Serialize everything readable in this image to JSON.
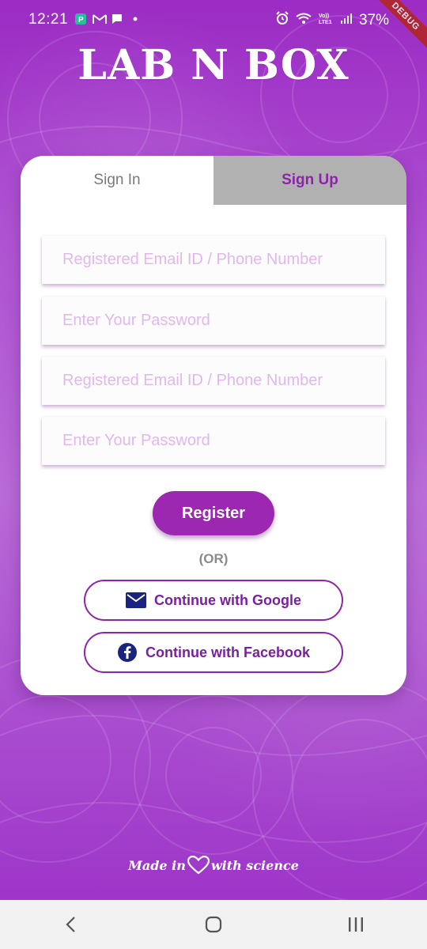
{
  "status_bar": {
    "time": "12:21",
    "battery": "37%",
    "left_icons": [
      "pay-icon",
      "gmail-icon",
      "message-icon",
      "dot-icon"
    ],
    "right_icons": [
      "alarm-icon",
      "wifi-icon",
      "volte-icon",
      "signal-icon"
    ],
    "debug_label": "DEBUG"
  },
  "app": {
    "logo": "LAB N BOX"
  },
  "tabs": {
    "sign_in": "Sign In",
    "sign_up": "Sign Up"
  },
  "form": {
    "field1_placeholder": "Registered Email ID / Phone Number",
    "field2_placeholder": "Enter Your Password",
    "field3_placeholder": "Registered Email ID / Phone Number",
    "field4_placeholder": "Enter Your Password",
    "register_label": "Register",
    "or_label": "(OR)",
    "google_label": "Continue with Google",
    "facebook_label": "Continue with Facebook"
  },
  "footer": {
    "made_in": "Made in",
    "with_science": "with science"
  },
  "colors": {
    "primary": "#9c27b0",
    "tab_inactive_bg": "#b1b1b1",
    "placeholder": "#e2b7ec"
  }
}
